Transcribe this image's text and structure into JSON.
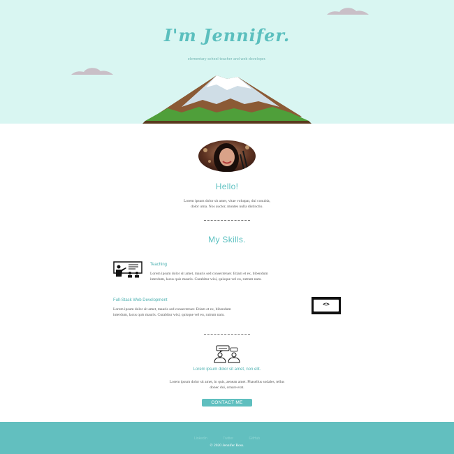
{
  "hero": {
    "title": "I'm Jennifer.",
    "subtitle": "elementary school teacher and web developer."
  },
  "about": {
    "heading": "Hello!",
    "text_line1": "Lorem ipsum dolor sit amet, vitae volutpat, dui conubia,",
    "text_line2": "dolor urna. Nos auctor, montes nulla distinctio."
  },
  "skills": {
    "heading": "My Skills.",
    "items": [
      {
        "title": "Teaching",
        "line1": "Lorem ipsum dolor sit amet, mauris sed consectetuer. Etiam et ex, bibendum",
        "line2": "interdum, lacus quis mauris. Curabitur wisi, quisque vel eu, rutrum nam.",
        "icon": "teacher-classroom-icon"
      },
      {
        "title": "Full-Stack Web Development",
        "line1": "Lorem ipsum dolor sit amet, mauris sed consectetuer. Etiam et ex, bibendum",
        "line2": "interdum, lacus quis mauris. Curabitur wisi, quisque vel eu, rutrum nam.",
        "icon": "code-brackets-icon"
      }
    ]
  },
  "cta": {
    "icon": "people-conversation-icon",
    "heading": "Lorem ipsum dolor sit amet, non elit.",
    "text_line1": "Lorem ipsum dolor sit amet, in quis, aenean amet. Phasellus sodales, tellus",
    "text_line2": "donec dui, ornare erat.",
    "button": "CONTACT ME",
    "code_icon_text": "<>"
  },
  "footer": {
    "links": [
      "LinkedIn",
      "Twitter",
      "GitHub"
    ],
    "copyright": "© 2020 Jennifer Ross."
  },
  "colors": {
    "accent": "#5bc0c0",
    "hero_bg": "#d9f6f2",
    "footer_bg": "#62bfbf"
  }
}
